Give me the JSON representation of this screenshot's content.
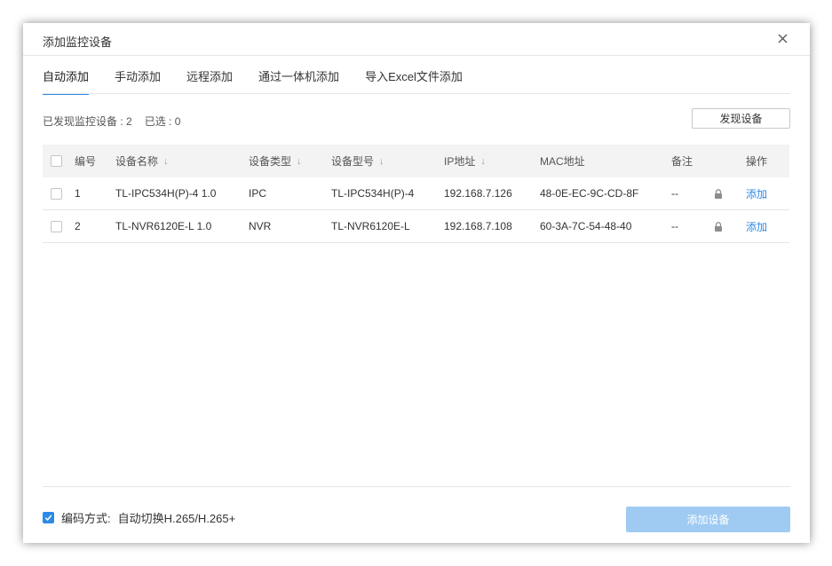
{
  "dialog": {
    "title": "添加监控设备",
    "close_icon": "close-icon"
  },
  "tabs": [
    {
      "label": "自动添加",
      "active": true
    },
    {
      "label": "手动添加",
      "active": false
    },
    {
      "label": "远程添加",
      "active": false
    },
    {
      "label": "通过一体机添加",
      "active": false
    },
    {
      "label": "导入Excel文件添加",
      "active": false
    }
  ],
  "summary": {
    "found": "已发现监控设备 : 2",
    "selected": "已选 : 0"
  },
  "discover_button": "发现设备",
  "table": {
    "headers": {
      "index": "编号",
      "name": "设备名称",
      "type": "设备类型",
      "model": "设备型号",
      "ip": "IP地址",
      "mac": "MAC地址",
      "note": "备注",
      "action": "操作"
    },
    "sort_icon": "sort-arrow-icon",
    "rows": [
      {
        "index": "1",
        "name": "TL-IPC534H(P)-4 1.0",
        "type": "IPC",
        "model": "TL-IPC534H(P)-4",
        "ip": "192.168.7.126",
        "mac": "48-0E-EC-9C-CD-8F",
        "note": "--",
        "lock_icon": "lock-icon",
        "action": "添加"
      },
      {
        "index": "2",
        "name": "TL-NVR6120E-L 1.0",
        "type": "NVR",
        "model": "TL-NVR6120E-L",
        "ip": "192.168.7.108",
        "mac": "60-3A-7C-54-48-40",
        "note": "--",
        "lock_icon": "lock-icon",
        "action": "添加"
      }
    ]
  },
  "encoding": {
    "checked": true,
    "label": "编码方式:",
    "value": "自动切换H.265/H.265+"
  },
  "add_button": "添加设备",
  "colors": {
    "accent": "#2d8ae6",
    "add_button_disabled": "#9fcbf3"
  }
}
